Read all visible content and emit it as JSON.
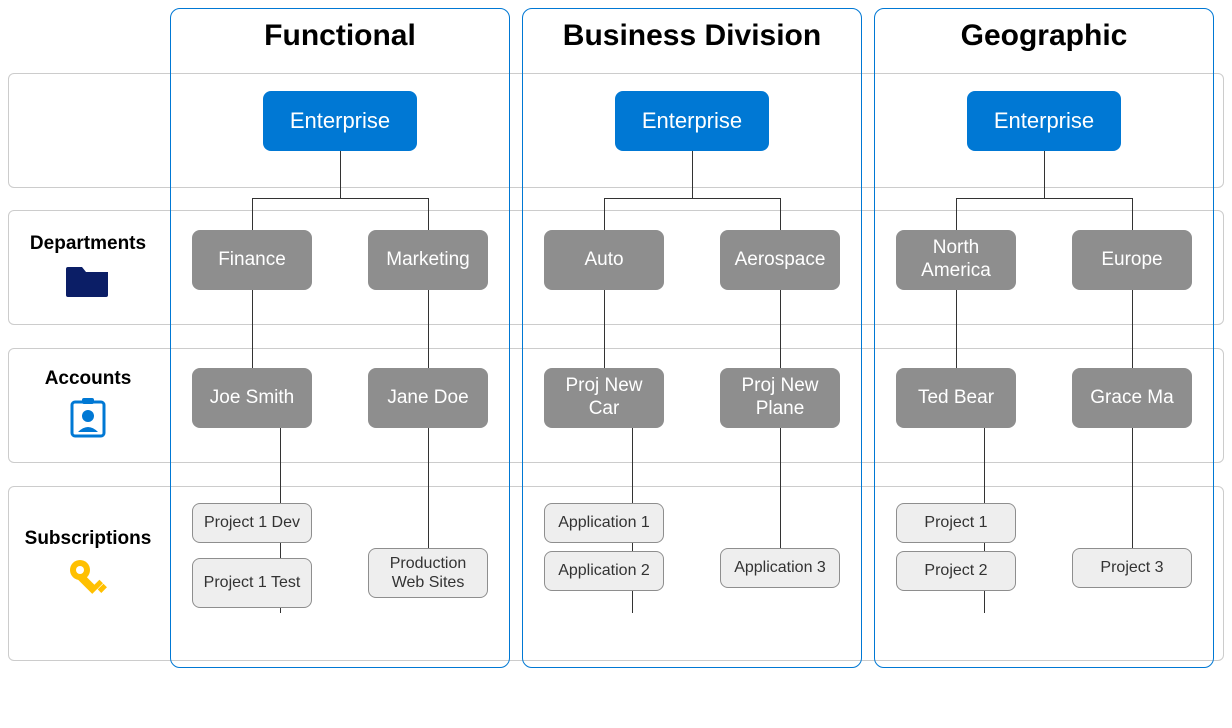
{
  "rowLabels": {
    "departments": "Departments",
    "accounts": "Accounts",
    "subscriptions": "Subscriptions"
  },
  "columns": [
    {
      "title": "Functional",
      "enterprise": "Enterprise",
      "departments": [
        "Finance",
        "Marketing"
      ],
      "accounts": [
        "Joe Smith",
        "Jane Doe"
      ],
      "subscriptions": [
        [
          "Project 1 Dev",
          "Project 1 Test"
        ],
        [
          "Production Web Sites"
        ]
      ]
    },
    {
      "title": "Business Division",
      "enterprise": "Enterprise",
      "departments": [
        "Auto",
        "Aerospace"
      ],
      "accounts": [
        "Proj New Car",
        "Proj New Plane"
      ],
      "subscriptions": [
        [
          "Application 1",
          "Application 2"
        ],
        [
          "Application 3"
        ]
      ]
    },
    {
      "title": "Geographic",
      "enterprise": "Enterprise",
      "departments": [
        "North America",
        "Europe"
      ],
      "accounts": [
        "Ted Bear",
        "Grace Ma"
      ],
      "subscriptions": [
        [
          "Project 1",
          "Project 2"
        ],
        [
          "Project 3"
        ]
      ]
    }
  ],
  "colors": {
    "enterprise": "#0078d4",
    "node": "#8e8e8e",
    "sub": "#eeeeee",
    "folder": "#0b1e66",
    "accountIcon": "#0078d4",
    "keyIcon": "#ffc000"
  }
}
